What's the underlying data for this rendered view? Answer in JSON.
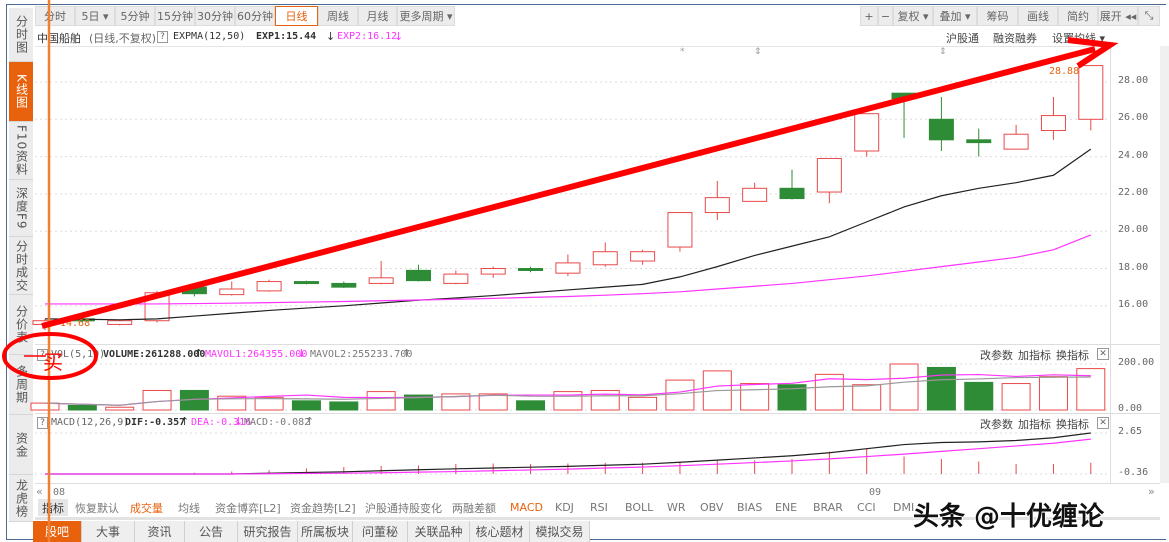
{
  "sidebar": {
    "items": [
      {
        "label": "分时图"
      },
      {
        "label": "K线图",
        "active": true
      },
      {
        "label": "F10资料"
      },
      {
        "label": "深度F9"
      },
      {
        "label": "分时成交"
      },
      {
        "label": "分价表"
      },
      {
        "label": "多周期"
      },
      {
        "label": "资金"
      },
      {
        "label": "龙虎榜"
      }
    ]
  },
  "period_tabs": [
    "分时",
    "5日 ▾",
    "5分钟",
    "15分钟",
    "30分钟",
    "60分钟",
    "日线",
    "周线",
    "月线",
    "更多周期 ▾"
  ],
  "active_period": "日线",
  "tools": [
    "+",
    "−",
    "复权 ▾",
    "叠加 ▾",
    "筹码",
    "画线",
    "简约",
    "展开 ◂◂",
    "⤡"
  ],
  "info": {
    "stock": "中国船舶",
    "mode": "(日线,不复权)",
    "help": "?",
    "indicator": "EXPMA(12,50)",
    "exp1": "EXP1:15.44",
    "exp1_arrow": "↓",
    "exp2": "EXP2:16.12",
    "exp2_arrow": "↓",
    "links": [
      "沪股通",
      "融资融券",
      "设置均线 ▾"
    ]
  },
  "volume_header": {
    "help": "?",
    "name": "VOL(5,10)",
    "volume": "VOLUME:261288.000",
    "volume_arrow": "↑",
    "mavol1": "MAVOL1:264355.000",
    "mavol1_arrow": "↓",
    "mavol2": "MAVOL2:255233.700",
    "mavol2_arrow": "↑"
  },
  "macd_header": {
    "help": "?",
    "name": "MACD(12,26,9)",
    "dif": "DIF:-0.357",
    "dif_arrow": "↑",
    "dea": "DEA:-0.316",
    "dea_arrow": "↓",
    "macd": "MACD:-0.082",
    "macd_arrow": "↑"
  },
  "panel_links": [
    "改参数",
    "加指标",
    "换指标"
  ],
  "close": "✕",
  "date_axis": {
    "left": "08",
    "right": "09",
    "prev": "«",
    "next": "»"
  },
  "indicator_tabs": [
    {
      "label": "指标",
      "style": "head"
    },
    {
      "label": "恢复默认"
    },
    {
      "label": "成交量",
      "style": "hot"
    },
    {
      "label": "均线"
    },
    {
      "label": "资金博弈[L2]"
    },
    {
      "label": "资金趋势[L2]"
    },
    {
      "label": "沪股通持股变化"
    },
    {
      "label": "两融差额"
    },
    {
      "label": "MACD",
      "style": "hot"
    },
    {
      "label": "KDJ"
    },
    {
      "label": "RSI"
    },
    {
      "label": "BOLL"
    },
    {
      "label": "WR"
    },
    {
      "label": "OBV"
    },
    {
      "label": "BIAS"
    },
    {
      "label": "ENE"
    },
    {
      "label": "BRAR"
    },
    {
      "label": "CCI"
    },
    {
      "label": "DMI"
    }
  ],
  "bottom_tabs": [
    "股吧",
    "大事",
    "资讯",
    "公告",
    "研究报告",
    "所属板块",
    "问董秘",
    "关联品种",
    "核心题材",
    "模拟交易"
  ],
  "annotation": {
    "buy_mark": "买",
    "watermark": "头条 @十优缠论"
  },
  "colors": {
    "up": "#e84a4a",
    "down": "#2f8c36",
    "exp1": "#222222",
    "exp2": "#ff33ff",
    "accent": "#e8620e",
    "annot": "#ff0000"
  },
  "chart_data": [
    {
      "type": "candlestick",
      "title": "中国船舶 日线",
      "ylim": [
        14.4,
        29.5
      ],
      "yticks": [
        "28.00",
        "26.00",
        "24.00",
        "22.00",
        "20.00",
        "18.00",
        "16.00"
      ],
      "low_label": "14.68",
      "high_label": "28.88",
      "ohlc": [
        [
          15.0,
          15.2,
          15.3,
          14.68
        ],
        [
          15.3,
          15.2,
          15.3,
          15.1
        ],
        [
          15.0,
          15.2,
          15.25,
          14.95
        ],
        [
          15.2,
          16.7,
          16.8,
          15.1
        ],
        [
          17.0,
          16.65,
          17.1,
          16.5
        ],
        [
          16.6,
          16.9,
          17.3,
          16.55
        ],
        [
          16.8,
          17.3,
          17.4,
          16.75
        ],
        [
          17.3,
          17.2,
          17.35,
          17.15
        ],
        [
          17.2,
          17.0,
          17.3,
          16.95
        ],
        [
          17.2,
          17.5,
          18.4,
          17.15
        ],
        [
          17.9,
          17.35,
          18.2,
          17.3
        ],
        [
          17.2,
          17.7,
          17.9,
          17.15
        ],
        [
          17.7,
          18.0,
          18.1,
          17.5
        ],
        [
          18.0,
          17.9,
          18.1,
          17.8
        ],
        [
          17.75,
          18.3,
          18.75,
          17.6
        ],
        [
          18.2,
          18.9,
          19.4,
          18.1
        ],
        [
          18.4,
          18.9,
          19.0,
          18.2
        ],
        [
          19.15,
          21.0,
          21.0,
          18.9
        ],
        [
          21.0,
          21.8,
          22.7,
          20.6
        ],
        [
          21.6,
          22.3,
          22.6,
          21.6
        ],
        [
          22.3,
          21.75,
          23.3,
          21.7
        ],
        [
          22.1,
          23.9,
          23.9,
          21.5
        ],
        [
          24.3,
          26.3,
          26.3,
          24.0
        ],
        [
          27.4,
          27.1,
          27.4,
          25.0
        ],
        [
          26.0,
          24.9,
          27.2,
          24.3
        ],
        [
          24.9,
          24.75,
          25.5,
          24.0
        ],
        [
          24.4,
          25.2,
          25.7,
          24.4
        ],
        [
          25.4,
          26.2,
          27.2,
          24.9
        ],
        [
          26.0,
          28.88,
          28.88,
          25.4
        ]
      ],
      "exp1": [
        15.3,
        15.28,
        15.25,
        15.3,
        15.45,
        15.6,
        15.75,
        15.88,
        16.0,
        16.15,
        16.3,
        16.42,
        16.55,
        16.7,
        16.85,
        17.0,
        17.15,
        17.55,
        18.1,
        18.7,
        19.2,
        19.7,
        20.5,
        21.3,
        21.9,
        22.3,
        22.6,
        23.0,
        24.4
      ],
      "exp2": [
        16.1,
        16.1,
        16.1,
        16.1,
        16.12,
        16.14,
        16.17,
        16.2,
        16.23,
        16.27,
        16.31,
        16.35,
        16.4,
        16.45,
        16.5,
        16.57,
        16.65,
        16.75,
        16.9,
        17.05,
        17.2,
        17.4,
        17.6,
        17.85,
        18.1,
        18.35,
        18.6,
        19.0,
        19.8
      ]
    },
    {
      "type": "bar",
      "title": "VOL(5,10)",
      "ylim": [
        0,
        200
      ],
      "yticks": [
        "200.00",
        "0.00"
      ],
      "values": [
        30,
        20,
        12,
        85,
        85,
        60,
        55,
        40,
        35,
        80,
        65,
        70,
        70,
        40,
        80,
        85,
        55,
        130,
        170,
        115,
        110,
        155,
        110,
        200,
        185,
        120,
        115,
        145,
        180
      ],
      "direction": [
        "up",
        "down",
        "up",
        "up",
        "down",
        "up",
        "up",
        "down",
        "down",
        "up",
        "down",
        "up",
        "up",
        "down",
        "up",
        "up",
        "up",
        "up",
        "up",
        "up",
        "down",
        "up",
        "up",
        "up",
        "down",
        "down",
        "up",
        "up",
        "up"
      ]
    },
    {
      "type": "line",
      "title": "MACD(12,26,9)",
      "ylim": [
        -0.5,
        2.9
      ],
      "yticks": [
        "2.65",
        "-0.36"
      ],
      "dif": [
        -0.36,
        -0.36,
        -0.36,
        -0.36,
        -0.36,
        -0.36,
        -0.3,
        -0.25,
        -0.2,
        -0.12,
        -0.05,
        0.02,
        0.08,
        0.14,
        0.2,
        0.28,
        0.36,
        0.5,
        0.66,
        0.82,
        0.98,
        1.2,
        1.5,
        1.8,
        1.95,
        2.0,
        2.1,
        2.3,
        2.65
      ],
      "dea": [
        -0.36,
        -0.36,
        -0.36,
        -0.36,
        -0.36,
        -0.36,
        -0.34,
        -0.32,
        -0.3,
        -0.27,
        -0.22,
        -0.18,
        -0.12,
        -0.06,
        0.0,
        0.08,
        0.15,
        0.25,
        0.36,
        0.48,
        0.6,
        0.75,
        0.92,
        1.1,
        1.3,
        1.5,
        1.7,
        1.9,
        2.2
      ],
      "macd": [
        0,
        0.02,
        0.02,
        0.02,
        0.05,
        0.1,
        0.15,
        0.22,
        0.28,
        0.32,
        0.34,
        0.4,
        0.42,
        0.4,
        0.42,
        0.45,
        0.45,
        0.5,
        0.55,
        0.55,
        0.6,
        0.9,
        1.0,
        0.7,
        0.6,
        0.5,
        0.4,
        0.4,
        0.45
      ]
    }
  ]
}
